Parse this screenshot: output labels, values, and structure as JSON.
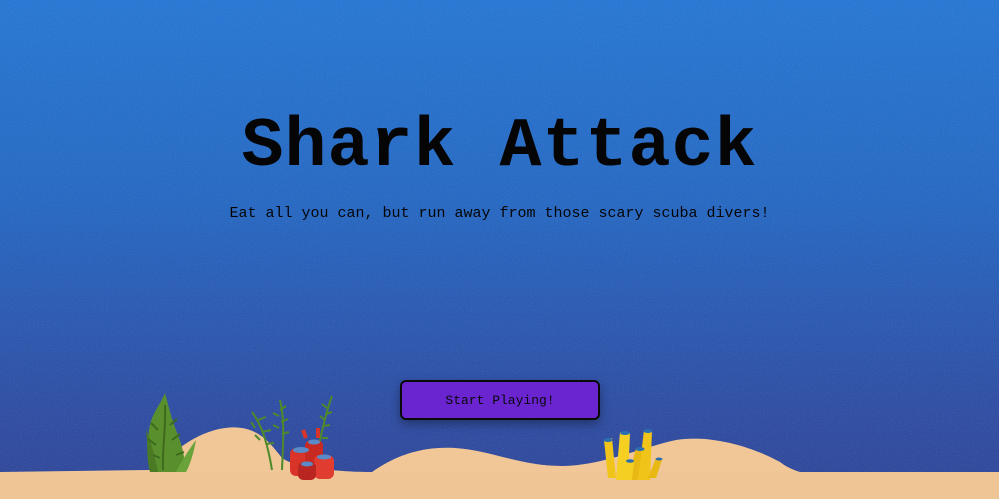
{
  "game": {
    "title": "Shark Attack",
    "tagline": "Eat all you can, but run away from those scary scuba divers!",
    "start_button": "Start Playing!"
  },
  "colors": {
    "water_top": "#1e73d6",
    "water_bottom": "#283f96",
    "button": "#6a24d0",
    "sand": "#f1c797"
  },
  "decorations": [
    "green-seaweed-icon",
    "red-coral-icon",
    "yellow-coral-icon",
    "sand-dunes"
  ]
}
